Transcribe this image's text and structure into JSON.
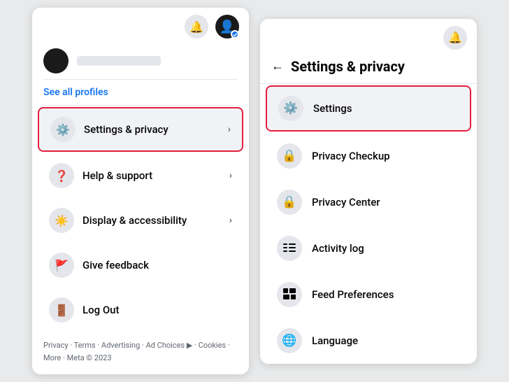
{
  "left_panel": {
    "see_all_profiles": "See all profiles",
    "menu_items": [
      {
        "id": "settings-privacy",
        "label": "Settings & privacy",
        "icon": "⚙",
        "has_chevron": true,
        "highlighted": true
      },
      {
        "id": "help-support",
        "label": "Help & support",
        "icon": "❓",
        "has_chevron": true,
        "highlighted": false
      },
      {
        "id": "display-accessibility",
        "label": "Display & accessibility",
        "icon": "☀",
        "has_chevron": true,
        "highlighted": false
      },
      {
        "id": "give-feedback",
        "label": "Give feedback",
        "icon": "⚑",
        "has_chevron": false,
        "highlighted": false
      },
      {
        "id": "log-out",
        "label": "Log Out",
        "icon": "⊖",
        "has_chevron": false,
        "highlighted": false
      }
    ],
    "footer": {
      "links": [
        "Privacy",
        "Terms",
        "Advertising",
        "Ad Choices",
        "Cookies"
      ],
      "copyright": "Meta © 2023"
    }
  },
  "right_panel": {
    "title": "Settings & privacy",
    "menu_items": [
      {
        "id": "settings",
        "label": "Settings",
        "icon": "⚙",
        "active": true
      },
      {
        "id": "privacy-checkup",
        "label": "Privacy Checkup",
        "icon": "🔒",
        "active": false
      },
      {
        "id": "privacy-center",
        "label": "Privacy Center",
        "icon": "🔒",
        "active": false
      },
      {
        "id": "activity-log",
        "label": "Activity log",
        "icon": "☰",
        "active": false
      },
      {
        "id": "feed-preferences",
        "label": "Feed Preferences",
        "icon": "▦",
        "active": false
      },
      {
        "id": "language",
        "label": "Language",
        "icon": "🌐",
        "active": false
      }
    ]
  },
  "icons": {
    "bell": "🔔",
    "back_arrow": "←",
    "chevron_right": "›"
  },
  "footer_text": "Privacy · Terms · Advertising · Ad Choices ▶ · Cookies · More · Meta © 2023"
}
